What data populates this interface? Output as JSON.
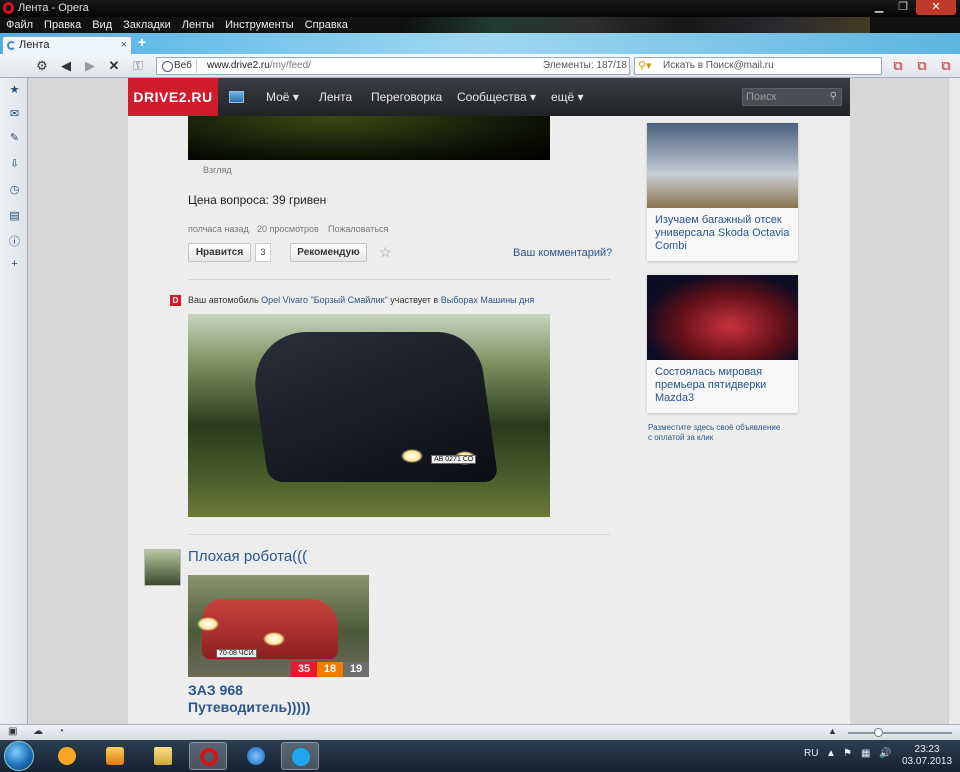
{
  "window": {
    "title": "Лента - Opera"
  },
  "menu": [
    "Файл",
    "Правка",
    "Вид",
    "Закладки",
    "Ленты",
    "Инструменты",
    "Справка"
  ],
  "tab": {
    "label": "Лента"
  },
  "address": {
    "mode_label": "Веб",
    "url_host": "www.drive2.ru",
    "url_path": "/my/feed/",
    "elements_label": "Элементы:",
    "elements_value": "187/18"
  },
  "search": {
    "placeholder": "Искать в Поиск@mail.ru"
  },
  "site": {
    "logo": "DRIVE2.RU",
    "nav": [
      "Моё ▾",
      "Лента",
      "Переговорка",
      "Сообщества ▾",
      "ещё ▾"
    ],
    "search_placeholder": "Поиск"
  },
  "post1": {
    "photo_caption": "Взгляд",
    "price_text": "Цена вопроса: 39 гривен",
    "meta_time": "полчаса назад",
    "meta_views": "20 просмотров",
    "meta_report": "Пожаловаться",
    "like_label": "Нравится",
    "like_count": "3",
    "recommend_label": "Рекомендую",
    "comment_link": "Ваш комментарий?"
  },
  "notice": {
    "icon_letter": "D",
    "prefix": "Ваш автомобиль ",
    "car_link": "Opel Vivaro \"Борзый Смайлик\"",
    "middle": " участвует в ",
    "contest_link": "Выборах Машины дня",
    "plate": "АВ 0271 СО"
  },
  "post2": {
    "title": "Плохая робота(((",
    "car_title_1": "ЗАЗ 968",
    "car_title_2": "Путеводитель)))))",
    "stats": [
      "35",
      "18",
      "19"
    ],
    "plate": "70-08 ЧСИ"
  },
  "ads": [
    {
      "caption": "Изучаем багажный отсек универсала Skoda Octavia Combi"
    },
    {
      "caption": "Состоялась мировая премьера пятидверки Mazda3"
    }
  ],
  "ad_link": {
    "line1": "Разместите здесь своё объявление",
    "line2": "с оплатой за клик"
  },
  "tray": {
    "lang": "RU",
    "time": "23:23",
    "date": "03.07.2013"
  },
  "colors": {
    "brand_red": "#d01c2a",
    "link": "#2a568a",
    "stat_red": "#e8192c",
    "stat_orange": "#f07d00",
    "stat_gray": "#6d6d6d"
  }
}
